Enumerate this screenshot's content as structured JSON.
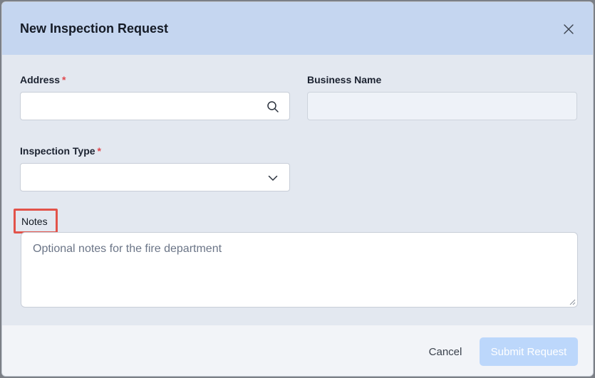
{
  "modal": {
    "title": "New Inspection Request",
    "close_icon": "close-icon"
  },
  "form": {
    "address": {
      "label": "Address",
      "required_marker": "*",
      "value": "",
      "placeholder": "",
      "icon": "search-icon"
    },
    "business_name": {
      "label": "Business Name",
      "value": "",
      "disabled": true
    },
    "inspection_type": {
      "label": "Inspection Type",
      "required_marker": "*",
      "selected": "",
      "icon": "chevron-down-icon"
    },
    "notes": {
      "label": "Notes",
      "value": "",
      "placeholder": "Optional notes for the fire department"
    }
  },
  "footer": {
    "cancel_label": "Cancel",
    "submit_label": "Submit Request",
    "submit_disabled": true
  },
  "colors": {
    "header_bg": "#c5d6f0",
    "body_bg": "#e3e8f0",
    "footer_bg": "#f2f4f8",
    "required": "#e0484e",
    "highlight_border": "#e2534a",
    "submit_disabled_bg": "#bcd7fb"
  }
}
